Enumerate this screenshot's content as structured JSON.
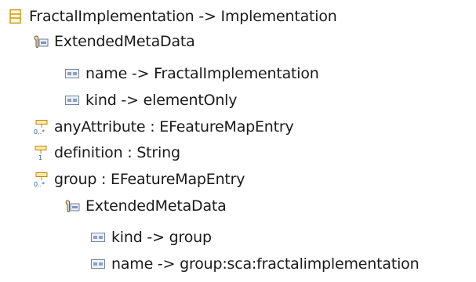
{
  "colors": {
    "class_icon": "#d4a020",
    "annotation_icon": "#8a7a5a",
    "detail_icon": "#5b7db3",
    "attribute_icon": "#c8a020",
    "multiplicity_text": "#3060b0"
  },
  "tree": {
    "root": {
      "label": "FractalImplementation -> Implementation",
      "icon": "eclass-icon"
    },
    "root_annotation": {
      "label": "ExtendedMetaData",
      "icon": "annotation-icon",
      "details": [
        {
          "label": "name -> FractalImplementation",
          "icon": "detail-entry-icon"
        },
        {
          "label": "kind -> elementOnly",
          "icon": "detail-entry-icon"
        }
      ]
    },
    "attributes": [
      {
        "label": "anyAttribute : EFeatureMapEntry",
        "icon": "eattribute-many-icon",
        "multiplicity": "0..*"
      },
      {
        "label": "definition : String",
        "icon": "eattribute-single-icon",
        "multiplicity": "1"
      },
      {
        "label": "group : EFeatureMapEntry",
        "icon": "eattribute-many-icon",
        "multiplicity": "0..*"
      }
    ],
    "group_annotation": {
      "label": "ExtendedMetaData",
      "icon": "annotation-icon",
      "details": [
        {
          "label": "kind -> group",
          "icon": "detail-entry-icon"
        },
        {
          "label": "name -> group:sca:fractalimplementation",
          "icon": "detail-entry-icon"
        }
      ]
    }
  }
}
